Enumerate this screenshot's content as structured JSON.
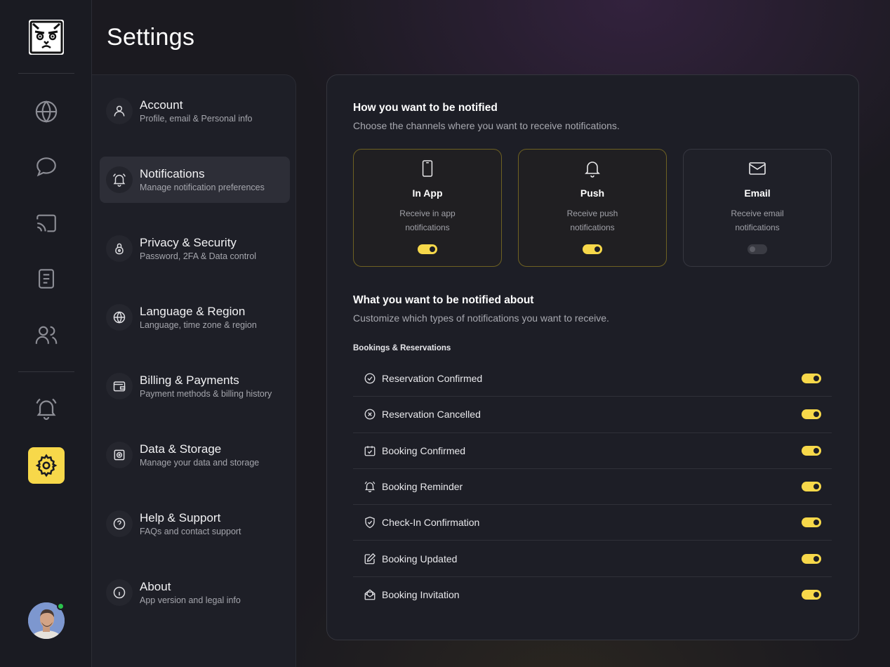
{
  "page": {
    "title": "Settings"
  },
  "rail": {
    "items": [
      {
        "icon": "globe-icon"
      },
      {
        "icon": "chat-icon"
      },
      {
        "icon": "cast-icon"
      },
      {
        "icon": "document-icon"
      },
      {
        "icon": "users-icon"
      },
      {
        "icon": "bell-icon"
      },
      {
        "icon": "gear-icon",
        "active": true
      }
    ],
    "accent": "#f7d84a"
  },
  "menu": {
    "items": [
      {
        "label": "Account",
        "sub": "Profile, email & Personal info",
        "icon": "user-icon"
      },
      {
        "label": "Notifications",
        "sub": "Manage notification preferences",
        "icon": "bell-icon",
        "active": true
      },
      {
        "label": "Privacy & Security",
        "sub": "Password, 2FA & Data control",
        "icon": "lock-icon"
      },
      {
        "label": "Language & Region",
        "sub": "Language, time zone & region",
        "icon": "globe-icon"
      },
      {
        "label": "Billing & Payments",
        "sub": "Payment methods & billing history",
        "icon": "wallet-icon"
      },
      {
        "label": "Data & Storage",
        "sub": "Manage your data and storage",
        "icon": "storage-icon"
      },
      {
        "label": "Help & Support",
        "sub": "FAQs and contact support",
        "icon": "help-icon"
      },
      {
        "label": "About",
        "sub": "App version and legal info",
        "icon": "info-icon"
      }
    ]
  },
  "channels": {
    "title": "How you want to be notified",
    "subtitle": "Choose the channels where you want to receive notifications.",
    "items": [
      {
        "name": "In App",
        "desc": "Receive in app notifications",
        "enabled": true,
        "icon": "phone-icon"
      },
      {
        "name": "Push",
        "desc": "Receive push notifications",
        "enabled": true,
        "icon": "bell-icon"
      },
      {
        "name": "Email",
        "desc": "Receive email notifications",
        "enabled": false,
        "icon": "mail-icon"
      }
    ]
  },
  "topics": {
    "title": "What you want to be notified about",
    "subtitle": "Customize which types of notifications you want to receive.",
    "group": "Bookings & Reservations",
    "items": [
      {
        "label": "Reservation Confirmed",
        "enabled": true,
        "icon": "check-circle-icon"
      },
      {
        "label": "Reservation Cancelled",
        "enabled": true,
        "icon": "x-circle-icon"
      },
      {
        "label": "Booking Confirmed",
        "enabled": true,
        "icon": "calendar-check-icon"
      },
      {
        "label": "Booking Reminder",
        "enabled": true,
        "icon": "alarm-bell-icon"
      },
      {
        "label": "Check-In Confirmation",
        "enabled": true,
        "icon": "shield-check-icon"
      },
      {
        "label": "Booking Updated",
        "enabled": true,
        "icon": "edit-icon"
      },
      {
        "label": "Booking Invitation",
        "enabled": true,
        "icon": "envelope-open-icon"
      }
    ]
  }
}
